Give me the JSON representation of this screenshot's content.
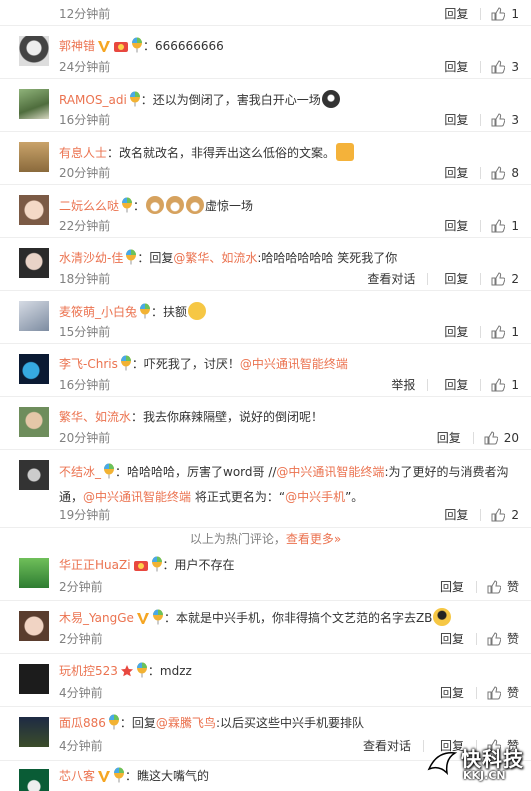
{
  "comments": [
    {
      "user": "",
      "text": "",
      "time": "12分钟前",
      "actions": [
        "回复"
      ],
      "likes": "1"
    },
    {
      "user": "郭神错",
      "text": "：666666666",
      "time": "24分钟前",
      "actions": [
        "回复"
      ],
      "likes": "3"
    },
    {
      "user": "RAMOS_adi",
      "text": "：还以为倒闭了，害我白开心一场",
      "time": "16分钟前",
      "actions": [
        "回复"
      ],
      "likes": "3"
    },
    {
      "user": "有息人士",
      "text": "：改名就改名，非得弄出这么低俗的文案。",
      "time": "20分钟前",
      "actions": [
        "回复"
      ],
      "likes": "8"
    },
    {
      "user": "二妧么么哒",
      "text": "：",
      "text2": "虚惊一场",
      "time": "22分钟前",
      "actions": [
        "回复"
      ],
      "likes": "1"
    },
    {
      "user": "水清沙幼-佳",
      "text": "：回复",
      "mention": "@繁华、如流水",
      "text2": ":哈哈哈哈哈哈 笑死我了你",
      "time": "18分钟前",
      "actions": [
        "查看对话",
        "回复"
      ],
      "likes": "2"
    },
    {
      "user": "麦筱萌_小白兔",
      "text": "：扶额",
      "time": "15分钟前",
      "actions": [
        "回复"
      ],
      "likes": "1"
    },
    {
      "user": "李飞-Chris",
      "text": "：吓死我了，讨厌！",
      "mention": "@中兴通讯智能终端",
      "time": "16分钟前",
      "actions": [
        "举报",
        "回复"
      ],
      "likes": "1"
    },
    {
      "user": "繁华、如流水",
      "text": "：我去你麻辣隔壁，说好的倒闭呢！",
      "time": "20分钟前",
      "actions": [
        "回复"
      ],
      "likes": "20"
    },
    {
      "user": "不结冰_",
      "text": "：哈哈哈哈，厉害了word哥 //",
      "mention": "@中兴通讯智能终端",
      "text2": ":为了更好的与消费者沟",
      "line2_mention": "@中兴通讯智能终端",
      "line2_text": "通，",
      "line2_text2": " 将正式更名为：“",
      "line2_mention2": "@中兴手机",
      "line2_text3": "”。",
      "time": "19分钟前",
      "actions": [
        "回复"
      ],
      "likes": "2"
    },
    {
      "user": "华正正HuaZi",
      "text": "：用户不存在",
      "time": "2分钟前",
      "actions": [
        "回复"
      ],
      "likes": "赞"
    },
    {
      "user": "木易_YangGe",
      "text": "：本就是中兴手机，你非得搞个文艺范的名字去ZB",
      "time": "2分钟前",
      "actions": [
        "回复"
      ],
      "likes": "赞"
    },
    {
      "user": "玩机控523",
      "text": "：mdzz",
      "time": "4分钟前",
      "actions": [
        "回复"
      ],
      "likes": "赞"
    },
    {
      "user": "面瓜886",
      "text": "：回复",
      "mention": "@霖騰飞鸟",
      "text2": ":以后买这些中兴手机要排队",
      "time": "4分钟前",
      "actions": [
        "查看对话",
        "回复"
      ],
      "likes": "赞"
    },
    {
      "user": "芯八客",
      "text": "：瞧这大嘴气的",
      "time": "",
      "actions": [],
      "likes": ""
    }
  ],
  "hot_divider": {
    "text": "以上为热门评论，",
    "more": "查看更多»"
  },
  "watermark": {
    "title": "快科技",
    "url": "KKJ.CN"
  },
  "colors": {
    "username": "#eb7350",
    "time": "#808080",
    "text": "#333333"
  }
}
